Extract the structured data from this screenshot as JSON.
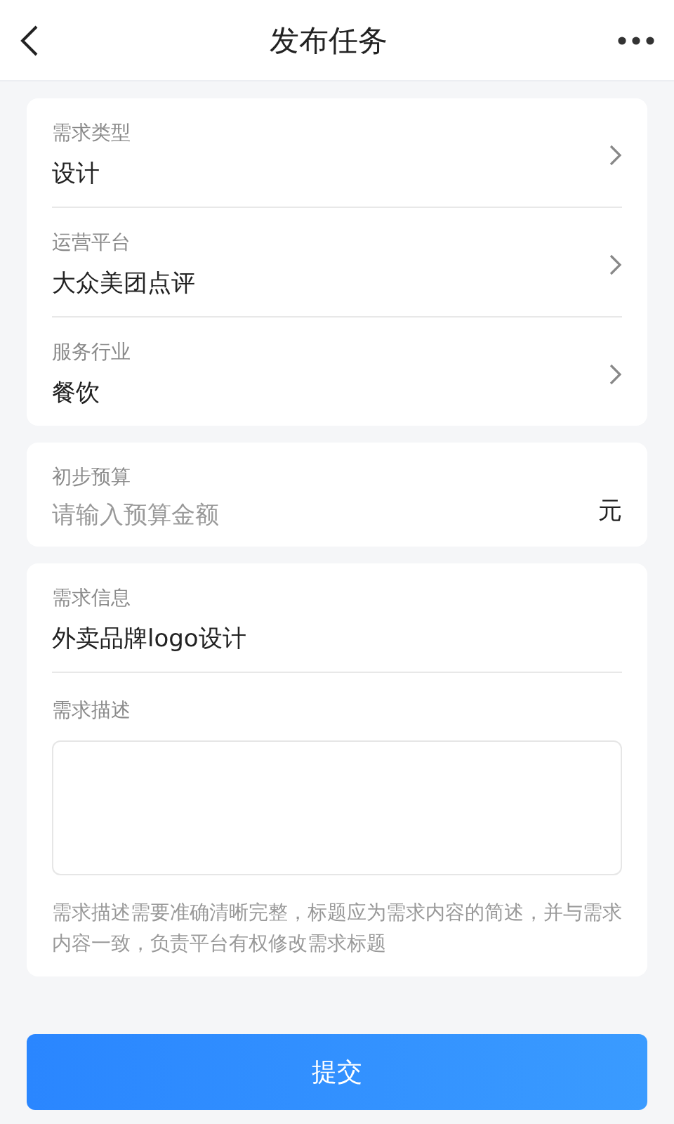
{
  "header": {
    "title": "发布任务"
  },
  "selectors": [
    {
      "label": "需求类型",
      "value": "设计"
    },
    {
      "label": "运营平台",
      "value": "大众美团点评"
    },
    {
      "label": "服务行业",
      "value": "餐饮"
    }
  ],
  "budget": {
    "label": "初步预算",
    "placeholder": "请输入预算金额",
    "unit": "元"
  },
  "info": {
    "label": "需求信息",
    "value": "外卖品牌logo设计",
    "description_label": "需求描述",
    "hint": "需求描述需要准确清晰完整，标题应为需求内容的简述，并与需求内容一致，负责平台有权修改需求标题"
  },
  "submit": "提交"
}
